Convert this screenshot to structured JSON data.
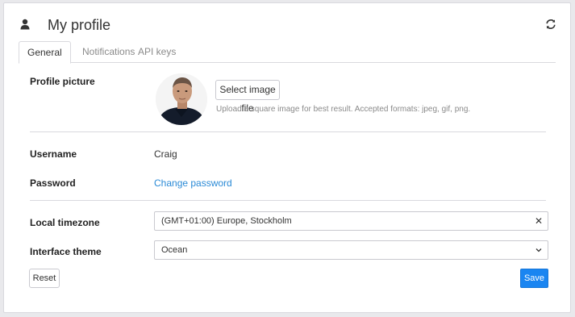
{
  "header": {
    "title": "My profile",
    "title_icon": "user-icon",
    "refresh_icon": "refresh-icon"
  },
  "tabs": [
    {
      "label": "General",
      "active": true
    },
    {
      "label": "Notifications",
      "active": false
    },
    {
      "label": "API keys",
      "active": false
    }
  ],
  "profile_picture": {
    "label": "Profile picture",
    "select_button": "Select image file",
    "hint": "Upload a square image for best result. Accepted formats: jpeg, gif, png."
  },
  "username": {
    "label": "Username",
    "value": "Craig"
  },
  "password": {
    "label": "Password",
    "link": "Change password"
  },
  "timezone": {
    "label": "Local timezone",
    "value": "(GMT+01:00) Europe, Stockholm",
    "clear_icon": "✕"
  },
  "theme": {
    "label": "Interface theme",
    "value": "Ocean"
  },
  "actions": {
    "reset": "Reset",
    "save": "Save"
  },
  "colors": {
    "accent": "#1a85f1",
    "link": "#2a8ad6"
  }
}
